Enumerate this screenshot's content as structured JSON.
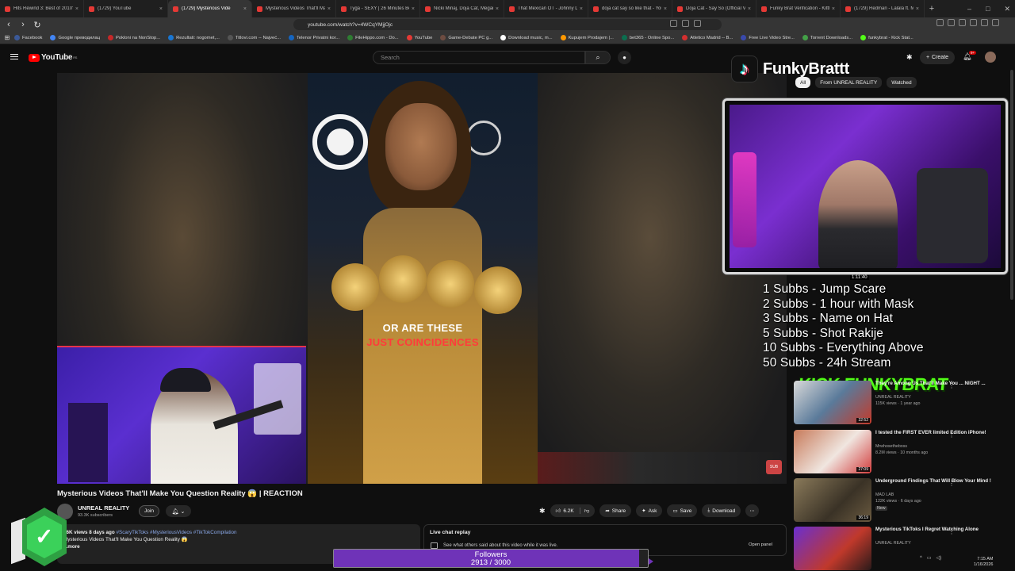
{
  "browser": {
    "tabs": [
      {
        "title": "Hits Rewind 3: Best of 2010's",
        "active": false
      },
      {
        "title": "(1729) YouTube",
        "active": false
      },
      {
        "title": "(1729) Mysterious Vide",
        "active": true
      },
      {
        "title": "Mysterious Videos That'll Make",
        "active": false
      },
      {
        "title": "Tyga - SEXY | 26 Minutes Best",
        "active": false
      },
      {
        "title": "Nicki Minaj, Doja Cat, Megan",
        "active": false
      },
      {
        "title": "That Mexican OT - Johnny De",
        "active": false
      },
      {
        "title": "doja cat say so like that - You",
        "active": false
      },
      {
        "title": "Doja Cat - Say So (Official Vide",
        "active": false
      },
      {
        "title": "Funky Brat Verification - Kittl",
        "active": false
      },
      {
        "title": "(1729) Redman - Lalala ft. Met",
        "active": false
      }
    ],
    "new_tab": "+",
    "url": "youtube.com/watch?v=4WCqYMjjOjc",
    "bookmarks": [
      "Facebook",
      "Google преводилац",
      "Pokloni na NonStop...",
      "Rezultati: nogomet,...",
      "Titlovi.com -- Najveć...",
      "Telenor Privatni kor...",
      "FileHippo.com - Do...",
      "YouTube",
      "Game-Debate PC g...",
      "Download music, m...",
      "Kupujem Prodajem |...",
      "bet365 - Online Spo...",
      "Atletico Madrid -- B...",
      "Free Live Video Stre...",
      "Torrent Downloads...",
      "funkybrat - Kick Stat..."
    ]
  },
  "youtube": {
    "logo": "YouTube",
    "region": "RS",
    "search_placeholder": "Search",
    "create_label": "Create",
    "notif_badge": "9+",
    "chips": [
      "All",
      "From UNREAL REALITY",
      "Watched"
    ],
    "video": {
      "caption_line1": "OR ARE THESE",
      "caption_line2": "JUST COINCIDENCES",
      "watermark": "SUB"
    },
    "title": "Mysterious Videos That'll Make You Question Reality 😱 | REACTION",
    "channel": {
      "name": "UNREAL REALITY",
      "subs": "93.3K subscribers"
    },
    "join_label": "Join",
    "actions": {
      "like": "6.2K",
      "share": "Share",
      "ask": "Ask",
      "save": "Save",
      "download": "Download"
    },
    "description": {
      "stats": "26K views  8 days ago",
      "tags": "#ScaryTikToks #MysteriousVideos #TikTokCompilation",
      "line2": "Mysterious Videos That'll Make You Question Reality 😱",
      "more": "...more"
    },
    "chat": {
      "title": "Live chat replay",
      "sub": "See what others said about this video while it was live.",
      "open": "Open panel"
    },
    "recommendations": [
      {
        "title": "They're Among Us That'll Make You ... NIGHT ...",
        "channel": "UNREAL REALITY",
        "meta": "115K views · 1 year ago",
        "duration": "32:52"
      },
      {
        "title": "I tested the FIRST EVER limited Edition iPhone!",
        "channel": "Mrwhosetheboss",
        "meta": "8.2M views · 10 months ago",
        "duration": "27:09"
      },
      {
        "title": "Underground Findings That Will Blow Your Mind !",
        "channel": "MAD LAB",
        "meta": "122K views · 6 days ago",
        "badge": "New",
        "duration": "36:19"
      },
      {
        "title": "Mysterious TikToks I Regret Watching Alone",
        "channel": "UNREAL REALITY",
        "meta": "",
        "duration": ""
      }
    ],
    "partial_duration": "1:11:40"
  },
  "overlay": {
    "tiktok_name": "FunkyBrattt",
    "subs_goals": [
      "1 Subbs - Jump Scare",
      "2 Subbs - 1 hour with Mask",
      "3 Subbs - Name on Hat",
      "5 Subbs - Shot Rakije",
      "10 Subbs - Everything Above",
      "50 Subbs - 24h Stream"
    ],
    "kick_text": "KICK FUNKYBRAT",
    "followers_label": "Followers",
    "followers_text": "2913 / 3000",
    "followers_progress": 0.971
  },
  "system": {
    "time": "7:15 AM",
    "date": "1/16/2026"
  }
}
